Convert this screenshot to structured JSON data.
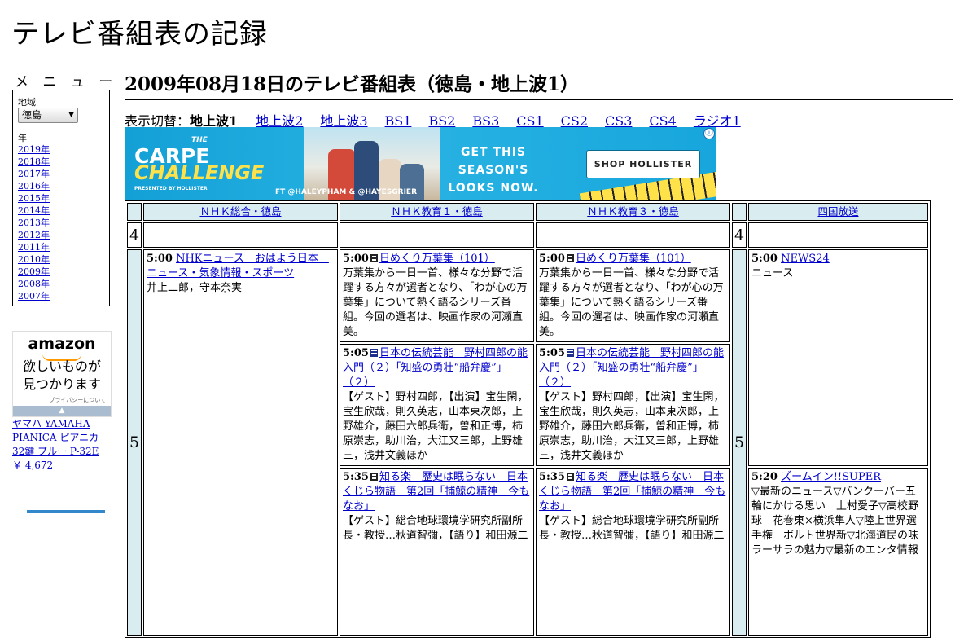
{
  "site": {
    "title": "テレビ番組表の記録"
  },
  "menu": {
    "heading": "メ ニ ュ ー",
    "region_label": "地域",
    "region_value": "徳島",
    "year_label": "年",
    "years": [
      "2019年",
      "2018年",
      "2017年",
      "2016年",
      "2015年",
      "2014年",
      "2013年",
      "2012年",
      "2011年",
      "2010年",
      "2009年",
      "2008年",
      "2007年"
    ]
  },
  "amazon_ad": {
    "logo": "amazon",
    "text_line1": "欲しいものが",
    "text_line2": "見つかります",
    "privacy": "プライバシーについて",
    "product_name": "ヤマハ YAMAHA PIANICA ピアニカ 32鍵 ブルー P-32E",
    "product_price": "￥ 4,672"
  },
  "page": {
    "heading": "2009年08月18日のテレビ番組表（徳島・地上波1）"
  },
  "switcher": {
    "label": "表示切替：",
    "current": "地上波1",
    "links": [
      "地上波2",
      "地上波3",
      "BS1",
      "BS2",
      "BS3",
      "CS1",
      "CS2",
      "CS3",
      "CS4",
      "ラジオ1"
    ]
  },
  "banner_ad": {
    "brand_small": "THE",
    "brand_main": "CARPE",
    "brand_script": "CHALLENGE",
    "brand_presented": "PRESENTED BY HOLLISTER",
    "tagline_line1": "GET THIS SEASON'S",
    "tagline_line2": "LOOKS NOW.",
    "credit": "FT @HALEYPHAM & @HAYESGRIER",
    "button": "SHOP HOLLISTER",
    "info": "ⓘ",
    "colors": {
      "background": "#1aa6dc",
      "accent": "#ffe14a"
    }
  },
  "schedule": {
    "channels": [
      "ＮＨＫ総合・徳島",
      "ＮＨＫ教育１・徳島",
      "ＮＨＫ教育３・徳島",
      "四国放送"
    ],
    "hours": [
      "4",
      "5"
    ],
    "programs": {
      "nhk_sogo": [
        {
          "time": "5:00",
          "title": "NHKニュース　おはよう日本　ニュース・気象情報・スポーツ",
          "desc": "井上二郎，守本奈実"
        }
      ],
      "nhk_kyoiku1": [
        {
          "time": "5:00",
          "icon": "genre-icon",
          "title": "日めくり万葉集（101）",
          "desc": "万葉集から一日一首、様々な分野で活躍する方々が選者となり、「わが心の万葉集」について熱く語るシリーズ番組。今回の選者は、映画作家の河瀬直美。"
        },
        {
          "time": "5:05",
          "icon": "subtitle-icon",
          "title": "日本の伝統芸能　野村四郎の能入門（２）「知盛の勇壮“船弁慶”」（２）",
          "desc": "【ゲスト】野村四郎，【出演】宝生閑，宝生欣哉，則久英志，山本東次郎，上野雄介，藤田六郎兵衛，曽和正博，柿原崇志，助川治，大江又三郎，上野雄三，浅井文義ほか"
        },
        {
          "time": "5:35",
          "icon": "genre-icon",
          "title": "知る楽　歴史は眠らない　日本くじら物語　第2回「捕鯨の精神　今もなお」",
          "desc": "【ゲスト】総合地球環境学研究所副所長・教授…秋道智彌，【語り】和田源二"
        }
      ],
      "nhk_kyoiku3": [
        {
          "time": "5:00",
          "icon": "genre-icon",
          "title": "日めくり万葉集（101）",
          "desc": "万葉集から一日一首、様々な分野で活躍する方々が選者となり、「わが心の万葉集」について熱く語るシリーズ番組。今回の選者は、映画作家の河瀬直美。"
        },
        {
          "time": "5:05",
          "icon": "subtitle-icon",
          "title": "日本の伝統芸能　野村四郎の能入門（２）「知盛の勇壮“船弁慶”」（２）",
          "desc": "【ゲスト】野村四郎，【出演】宝生閑，宝生欣哉，則久英志，山本東次郎，上野雄介，藤田六郎兵衛，曽和正博，柿原崇志，助川治，大江又三郎，上野雄三，浅井文義ほか"
        },
        {
          "time": "5:35",
          "icon": "genre-icon",
          "title": "知る楽　歴史は眠らない　日本くじら物語　第2回「捕鯨の精神　今もなお」",
          "desc": "【ゲスト】総合地球環境学研究所副所長・教授…秋道智彌，【語り】和田源二"
        }
      ],
      "shikoku": [
        {
          "time": "5:00",
          "title": "NEWS24",
          "desc": "ニュース"
        },
        {
          "time": "5:20",
          "title": "ズームイン!!SUPER",
          "desc": "▽最新のニュース▽バンクーバー五輪にかける思い　上村愛子▽高校野球　花巻東×横浜隼人▽陸上世界選手権　ボルト世界新▽北海道民の味ラーサラの魅力▽最新のエンタ情報"
        }
      ]
    }
  }
}
